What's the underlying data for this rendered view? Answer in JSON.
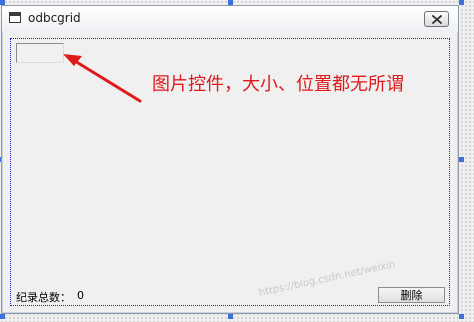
{
  "window": {
    "title": "odbcgrid",
    "close_icon": "close-icon"
  },
  "picture_control": {
    "label": ""
  },
  "annotation": {
    "text": "图片控件，大小、位置都无所谓",
    "color": "#e0191b"
  },
  "footer": {
    "count_label": "纪录总数：",
    "count_value": "0",
    "delete_label": "删除"
  },
  "watermark": {
    "text": "https://blog.csdn.net/weixin"
  },
  "colors": {
    "selection": "#3f6fd8",
    "dotted_border": "#1e1ec8"
  }
}
